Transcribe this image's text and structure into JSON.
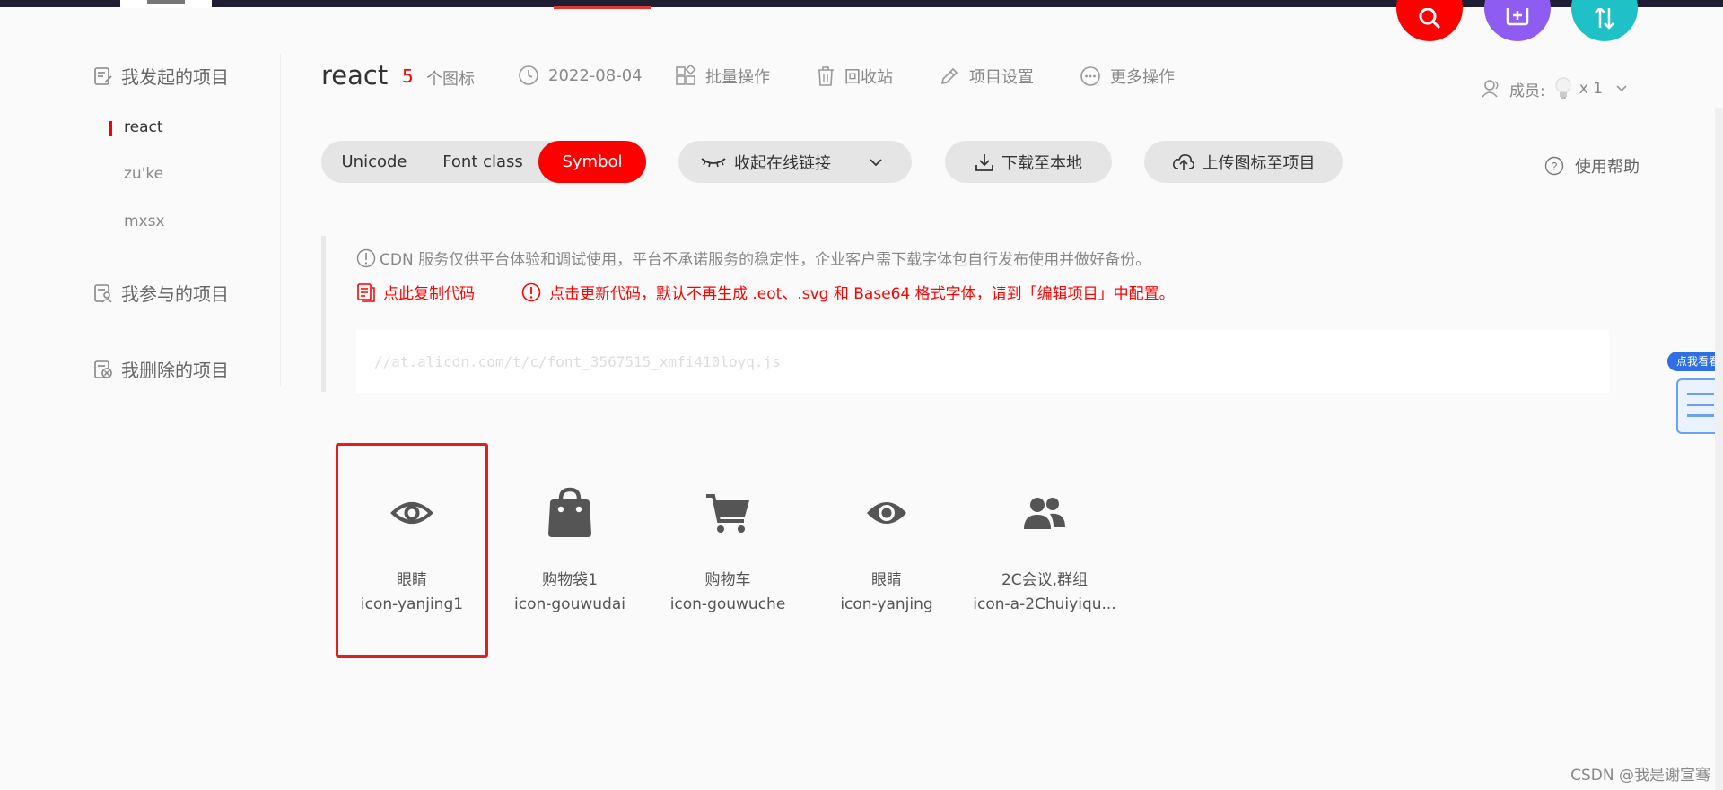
{
  "sidebar": {
    "my_projects": "我发起的项目",
    "projects": [
      "react",
      "zu'ke",
      "mxsx"
    ],
    "joined": "我参与的项目",
    "deleted": "我删除的项目"
  },
  "header": {
    "title": "react",
    "count": "5",
    "count_label": "个图标",
    "date": "2022-08-04",
    "batch": "批量操作",
    "recycle": "回收站",
    "settings": "项目设置",
    "more": "更多操作",
    "members_label": "成员:",
    "members_count": "x 1"
  },
  "toolbar": {
    "unicode": "Unicode",
    "font_class": "Font class",
    "symbol": "Symbol",
    "collapse_link": "收起在线链接",
    "download": "下载至本地",
    "upload": "上传图标至项目",
    "help": "使用帮助"
  },
  "cdn": {
    "notice": "CDN 服务仅供平台体验和调试使用，平台不承诺服务的稳定性，企业客户需下载字体包自行发布使用并做好备份。",
    "copy_code": "点此复制代码",
    "update_code": "点击更新代码，默认不再生成 .eot、.svg 和 Base64 格式字体，请到「编辑项目」中配置。",
    "url": "//at.alicdn.com/t/c/font_3567515_xmfi410loyq.js"
  },
  "side_widget": {
    "bubble": "点我看看"
  },
  "icons": [
    {
      "name": "眼睛",
      "code": "icon-yanjing1",
      "glyph": "eye-outline-icon"
    },
    {
      "name": "购物袋1",
      "code": "icon-gouwudai",
      "glyph": "shopping-bag-icon"
    },
    {
      "name": "购物车",
      "code": "icon-gouwuche",
      "glyph": "shopping-cart-icon"
    },
    {
      "name": "眼睛",
      "code": "icon-yanjing",
      "glyph": "eye-filled-icon"
    },
    {
      "name": "2C会议,群组",
      "code": "icon-a-2Chuiyiqu...",
      "glyph": "group-icon"
    }
  ],
  "watermark": "CSDN @我是谢宣骞"
}
